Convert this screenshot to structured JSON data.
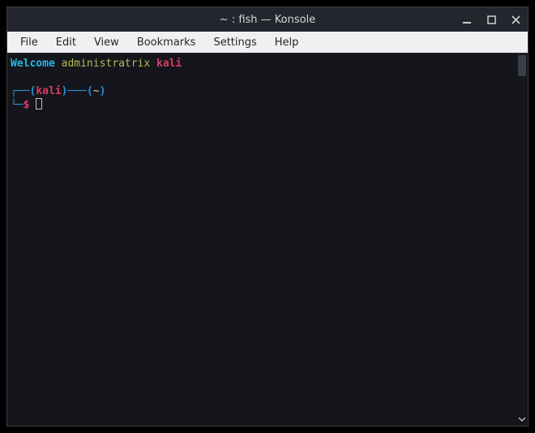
{
  "window": {
    "title": "~ : fish — Konsole"
  },
  "menubar": {
    "items": [
      "File",
      "Edit",
      "View",
      "Bookmarks",
      "Settings",
      "Help"
    ]
  },
  "terminal": {
    "welcome": {
      "word1": "Welcome",
      "word2": "administratrix",
      "word3": "kali"
    },
    "prompt": {
      "line_left": "┌──",
      "host_open": "(",
      "host": "kali",
      "host_close": ")",
      "line_mid": "───",
      "cwd_open": "(",
      "cwd": "~",
      "cwd_close": ")",
      "corner": "└─",
      "symbol": "$"
    }
  }
}
